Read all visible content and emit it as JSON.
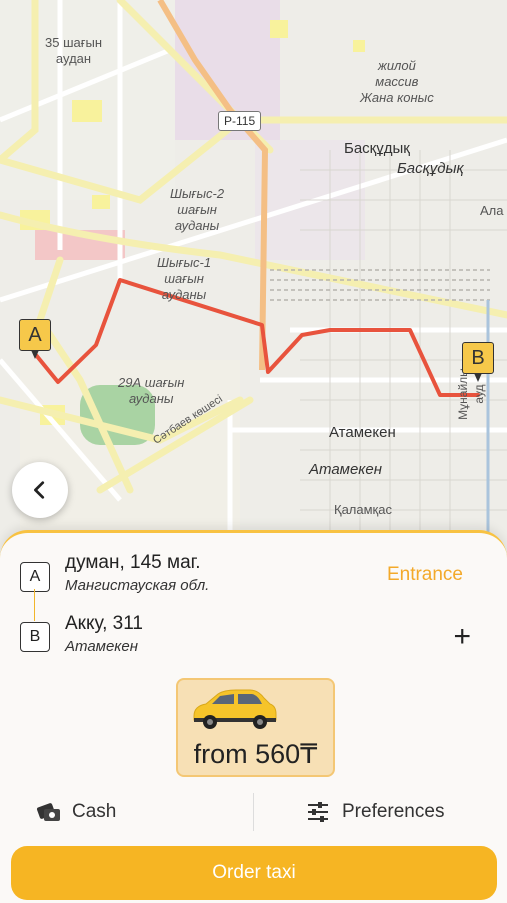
{
  "map": {
    "labels": {
      "district_35": "35 шағын\nаудан",
      "zhiloy": "жилой\nмассив\nЖана коныс",
      "road_shield": "Р-115",
      "baskuduk_1": "Басқұдық",
      "baskuduk_2": "Басқұдық",
      "ala": "Ала",
      "shygys2": "Шығыс-2\nшағын\nауданы",
      "shygys1": "Шығыс-1\nшағын\nауданы",
      "district_29a": "29А шағын\nауданы",
      "satbaev": "Сәтбаев көшесі",
      "atameken_1": "Атамекен",
      "atameken_2": "Атамекен",
      "kalamkas": "Қаламқас",
      "munaily": "Мұнайлы ауд"
    },
    "pin_a": "A",
    "pin_b": "B",
    "route_color": "#e8533d"
  },
  "back_button": {
    "icon": "chevron-left-icon"
  },
  "route": {
    "from": {
      "letter": "A",
      "title": "думан, 145 маг.",
      "subtitle": "Мангистауская обл."
    },
    "to": {
      "letter": "B",
      "title": "Акку, 311",
      "subtitle": "Атамекен"
    },
    "entrance_label": "Entrance",
    "add_stop_icon": "plus-icon",
    "add_stop_label": "+"
  },
  "tariff": {
    "price": "from 560₸",
    "icon": "car-icon"
  },
  "payment": {
    "label": "Cash",
    "icon": "cash-icon"
  },
  "preferences": {
    "label": "Preferences",
    "icon": "sliders-icon"
  },
  "order_button": {
    "label": "Order taxi"
  },
  "colors": {
    "accent": "#f6b523",
    "entrance": "#f3a92a",
    "tariff_bg": "#f7e0b5"
  }
}
